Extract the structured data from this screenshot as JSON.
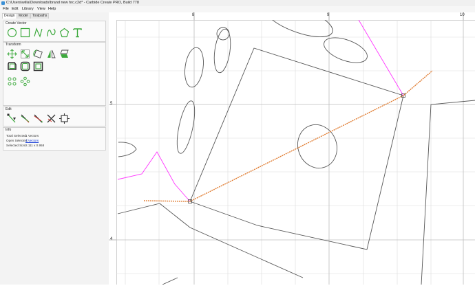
{
  "window": {
    "title": "C:\\Users\\willa\\Downloads\\brand new hrc.c2d* - Carbide Create PRO, Build 778"
  },
  "menu": {
    "items": [
      "File",
      "Edit",
      "Library",
      "View",
      "Help"
    ]
  },
  "tabs": [
    "Design",
    "Model",
    "Toolpaths"
  ],
  "sections": {
    "create_vector": {
      "title": "Create Vector",
      "tools": [
        "circle-icon",
        "rectangle-icon",
        "polyline-icon",
        "curve-icon",
        "polygon-icon",
        "text-icon"
      ]
    },
    "transform": {
      "title": "Transform",
      "tools": [
        "move-icon",
        "scale-icon",
        "rotate-icon",
        "mirror-icon",
        "skew-icon",
        "offset-icon",
        "fillet-icon",
        "boundary-icon",
        "align-icon",
        "array-icon"
      ]
    },
    "edit": {
      "title": "Edit",
      "tools": [
        "node-edit-icon",
        "trim-icon",
        "extend-icon",
        "split-icon",
        "bounding-box-icon"
      ]
    },
    "info": {
      "title": "Info",
      "total_selected_label": "Total Selected:",
      "total_selected_value": "1 Vectors",
      "open_selected_label": "Open Selected:",
      "open_selected_value": "1 Vectors",
      "selected_size_label": "Selected Size:",
      "selected_size_value": "2.111 x 0.958"
    }
  },
  "rulers": {
    "horizontal_labels": [
      "8",
      "9",
      "10"
    ],
    "vertical_labels": [
      "5",
      "4"
    ]
  },
  "colors": {
    "accent_green": "#3da93d",
    "selected_path": "#e07a2e",
    "magenta_path": "#ff33ff",
    "vector_gray": "#555555",
    "grid": "#dcdcdc"
  }
}
